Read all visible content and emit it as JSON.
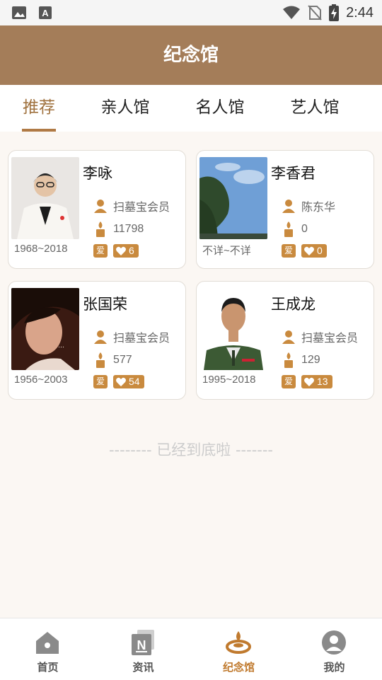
{
  "status_bar": {
    "time": "2:44"
  },
  "header": {
    "title": "纪念馆"
  },
  "tabs": [
    {
      "label": "推荐",
      "active": true
    },
    {
      "label": "亲人馆",
      "active": false
    },
    {
      "label": "名人馆",
      "active": false
    },
    {
      "label": "艺人馆",
      "active": false
    }
  ],
  "cards": [
    {
      "name": "李咏",
      "owner": "扫墓宝会员",
      "candles": "11798",
      "years": "1968~2018",
      "ai_label": "爱",
      "likes": "6"
    },
    {
      "name": "李香君",
      "owner": "陈东华",
      "candles": "0",
      "years": "不详~不详",
      "ai_label": "爱",
      "likes": "0"
    },
    {
      "name": "张国荣",
      "owner": "扫墓宝会员",
      "candles": "577",
      "years": "1956~2003",
      "ai_label": "爱",
      "likes": "54"
    },
    {
      "name": "王成龙",
      "owner": "扫墓宝会员",
      "candles": "129",
      "years": "1995~2018",
      "ai_label": "爱",
      "likes": "13"
    }
  ],
  "end_note": "-------- 已经到底啦 -------",
  "bottom_nav": [
    {
      "label": "首页",
      "icon": "home-icon",
      "active": false
    },
    {
      "label": "资讯",
      "icon": "news-icon",
      "active": false
    },
    {
      "label": "纪念馆",
      "icon": "memorial-icon",
      "active": true
    },
    {
      "label": "我的",
      "icon": "profile-icon",
      "active": false
    }
  ],
  "colors": {
    "brand": "#a47d59",
    "accent": "#c98a3e"
  }
}
